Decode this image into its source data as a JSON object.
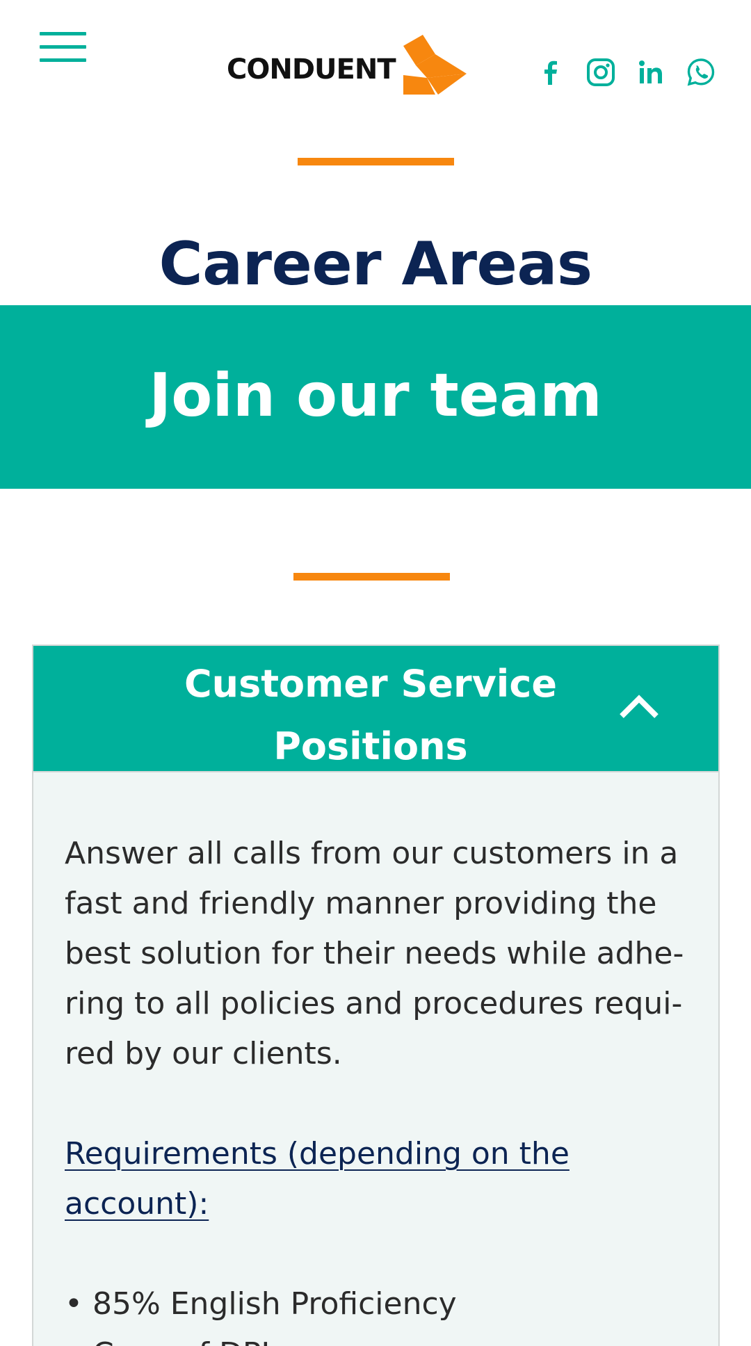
{
  "header": {
    "logo_text": "CONDUENT",
    "brand_colors": {
      "orange": "#f7870f",
      "teal": "#00b09b",
      "navy": "#0c2453"
    },
    "social": [
      "facebook-icon",
      "instagram-icon",
      "linkedin-icon",
      "whatsapp-icon"
    ]
  },
  "hero": {
    "title": "Career Areas",
    "banner_title": "Join our team"
  },
  "accordion": {
    "title": "Customer Service Positions",
    "expanded": true,
    "description": "Answer all calls from our customers in a fast and friendly manner providing the best solution for their needs while adhe­ring to all policies and procedures requi­red by our clients.",
    "requirements_heading": "Requirements (depending on the account): ",
    "requirements": [
      "85% English Proficiency",
      "Copy of DPI"
    ]
  }
}
